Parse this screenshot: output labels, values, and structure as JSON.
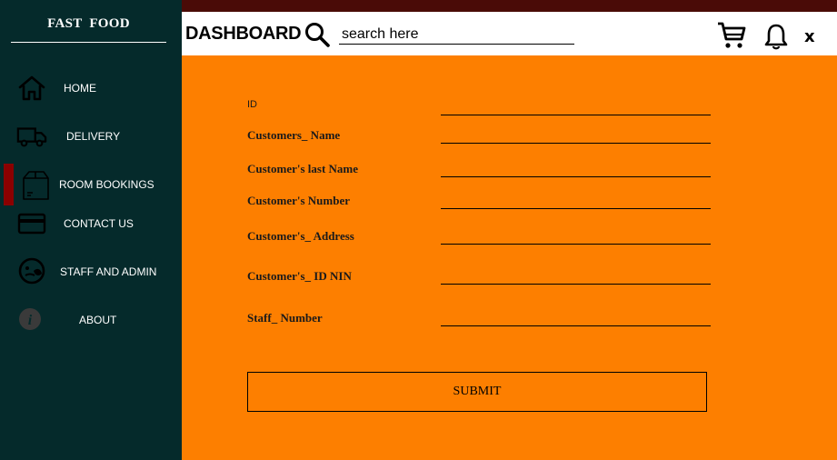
{
  "app": {
    "brand": "FAST  FOOD"
  },
  "sidebar": {
    "items": [
      {
        "label": "HOME",
        "icon": "home-icon"
      },
      {
        "label": "DELIVERY",
        "icon": "truck-icon"
      },
      {
        "label": "ROOM BOOKINGS",
        "icon": "box-icon",
        "active": true
      },
      {
        "label": "CONTACT US",
        "icon": "card-icon"
      },
      {
        "label": "STAFF AND ADMIN",
        "icon": "user-face-icon"
      },
      {
        "label": "ABOUT",
        "icon": "info-icon"
      }
    ],
    "active_color": "#8b0000"
  },
  "header": {
    "title": "DASHBOARD",
    "search_placeholder": "search here",
    "close_label": "x"
  },
  "form": {
    "fields": [
      {
        "label": "ID"
      },
      {
        "label": "Customers_ Name"
      },
      {
        "label": "Customer's last Name"
      },
      {
        "label": "Customer's Number"
      },
      {
        "label": "Customer's_ Address"
      },
      {
        "label": "Customer's_ ID NIN"
      },
      {
        "label": "Staff_ Number"
      }
    ],
    "submit_label": "SUBMIT"
  },
  "colors": {
    "sidebar_bg": "#052a2b",
    "main_bg": "#fd7f00",
    "top_strip": "#4a0b07"
  }
}
